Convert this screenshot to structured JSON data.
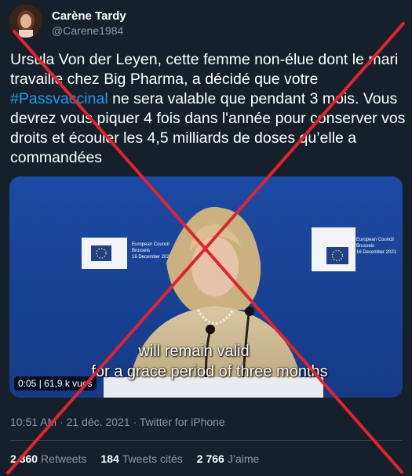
{
  "author": {
    "display_name": "Carène Tardy",
    "handle": "@Carene1984"
  },
  "tweet": {
    "text_part1": "Ursula Von der Leyen, cette femme non-élue dont le mari travaille chez Big Pharma, a décidé que votre ",
    "hashtag": "#Passvaccinal",
    "text_part2": " ne sera valable que pendant 3 mois. Vous devrez vous piquer 4 fois dans l'année pour conserver vos droits et écouler les 4,5 milliards de doses qu’elle a commandées"
  },
  "media": {
    "subtitle_line1": "will remain valid",
    "subtitle_line2": "for a grace period of three months",
    "badge": "0:05 | 61,9 k vues",
    "backdrop_label_line1": "European Council",
    "backdrop_label_line2": "Brussels",
    "backdrop_label_line3": "16 December 2021"
  },
  "meta": {
    "time": "10:51 AM",
    "separator": " · ",
    "date": "21 déc. 2021",
    "source": "Twitter for iPhone"
  },
  "stats": {
    "retweets_count": "2 860",
    "retweets_label": "Retweets",
    "quotes_count": "184",
    "quotes_label": "Tweets cités",
    "likes_count": "2 766",
    "likes_label": "J’aime"
  },
  "colors": {
    "background": "#15202b",
    "accent": "#1d9bf0",
    "secondary_text": "#8899a6",
    "overlay_x": "#e0242f"
  }
}
